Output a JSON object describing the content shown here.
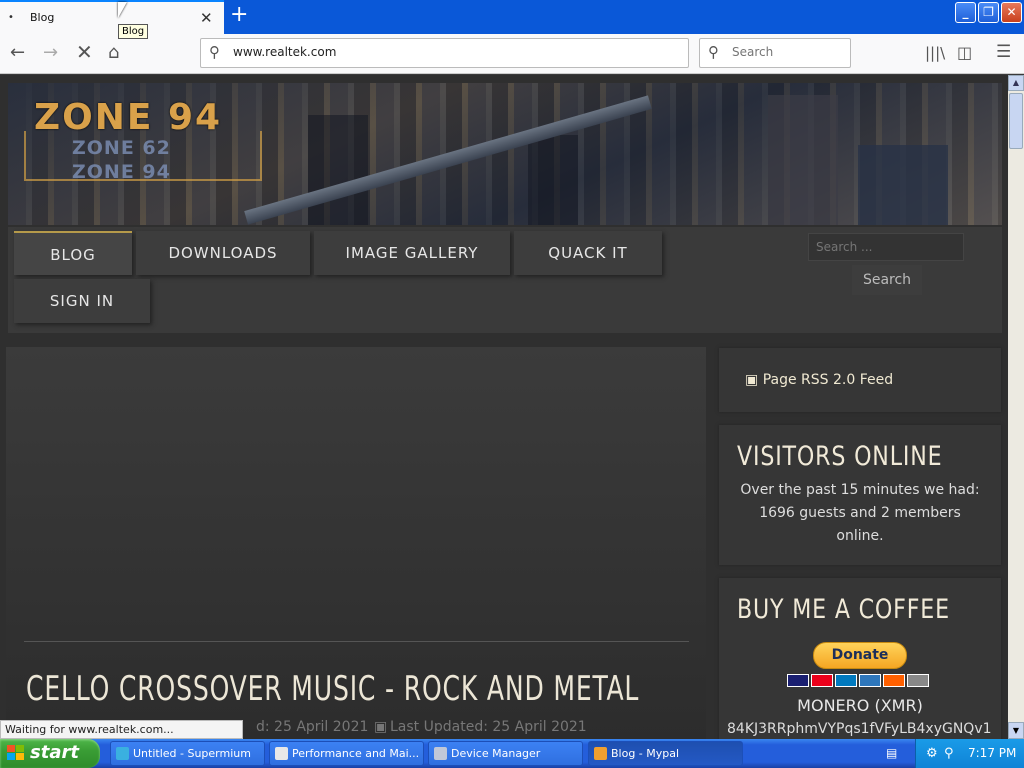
{
  "browser": {
    "tab_title": "Blog",
    "tab_tooltip": "Blog",
    "url": "www.realtek.com",
    "search_placeholder": "Search",
    "status_text": "Waiting for www.realtek.com..."
  },
  "site": {
    "logo_main": "ZONE 94",
    "logo_line2": "ZONE 62",
    "logo_line3": "ZONE 94",
    "menu": [
      "BLOG",
      "DOWNLOADS",
      "IMAGE GALLERY",
      "QUACK IT",
      "SIGN IN"
    ],
    "search_placeholder": "Search ...",
    "search_button": "Search"
  },
  "article": {
    "title": "CELLO CROSSOVER MUSIC - ROCK AND METAL",
    "published": "d: 25 April 2021",
    "updated": "Last Updated: 25 April 2021"
  },
  "sidebar": {
    "rss_label": "Page RSS 2.0 Feed",
    "visitors_title": "VISITORS ONLINE",
    "visitors_text": "Over the past 15 minutes we had: 1696 guests and 2 members online.",
    "coffee_title": "BUY ME A COFFEE",
    "donate_label": "Donate",
    "monero_label": "MONERO (XMR)",
    "monero_address": "84KJ3RRphmVYPqs1fVFyLB4xyGNQv1"
  },
  "taskbar": {
    "start_label": "start",
    "items": [
      "Untitled - Supermium",
      "Performance and Mai...",
      "Device Manager",
      "Blog - Mypal"
    ],
    "clock": "7:17 PM"
  },
  "colors": {
    "accent": "#d9a14a",
    "page_bg": "#2f2f2f",
    "xp_blue": "#245edb",
    "xp_green": "#3a9d35"
  }
}
